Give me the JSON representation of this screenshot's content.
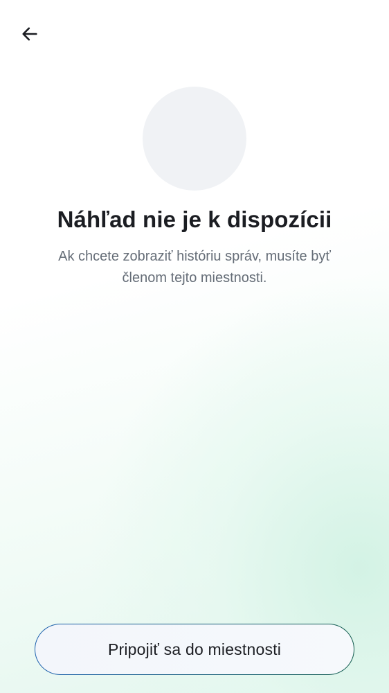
{
  "header": {
    "back_icon": "arrow-left-icon"
  },
  "preview": {
    "title": "Náhľad nie je k dispozícii",
    "message": "Ak chcete zobraziť históriu správ, musíte byť členom tejto miestnosti."
  },
  "actions": {
    "join_label": "Pripojiť sa do miestnosti"
  },
  "colors": {
    "text_primary": "#1b1d22",
    "text_secondary": "#656d77",
    "avatar_placeholder": "#f0f2f5",
    "button_border_start": "#1a5fae",
    "button_border_end": "#0f5a4c"
  }
}
